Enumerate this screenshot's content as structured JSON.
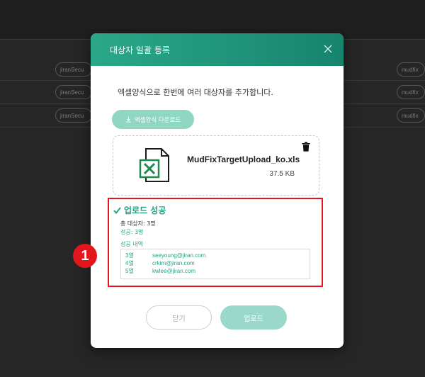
{
  "background": {
    "row_pills_left": [
      "jiranSecu",
      "jiranSecu",
      "jiranSecu"
    ],
    "row_pills_right": [
      "mudfix",
      "mudfix",
      "mudfix"
    ]
  },
  "modal": {
    "title": "대상자 일괄 등록",
    "close_icon": "close-icon",
    "intro": "엑셀양식으로 한번에 여러 대상자를 추가합니다.",
    "download_button": "엑셀양식 다운로드",
    "download_icon": "download-icon",
    "file": {
      "name": "MudFixTargetUpload_ko.xls",
      "size": "37.5 KB",
      "icon": "excel-icon"
    },
    "result": {
      "title": "업로드 성공",
      "total": "총 대상자: 3명",
      "success": "성공: 3명",
      "detail_label": "성공 내역",
      "rows": [
        {
          "row": "3열",
          "email": "seeyoung@jiran.com"
        },
        {
          "row": "4열",
          "email": "crkim@jiran.com"
        },
        {
          "row": "5열",
          "email": "kwlee@jiran.com"
        }
      ]
    },
    "callout_number": "1",
    "buttons": {
      "close": "닫기",
      "upload": "업로드"
    }
  },
  "colors": {
    "header_start": "#2aa889",
    "header_end": "#17846e",
    "accent": "#27a383",
    "highlight": "#e3161d"
  }
}
